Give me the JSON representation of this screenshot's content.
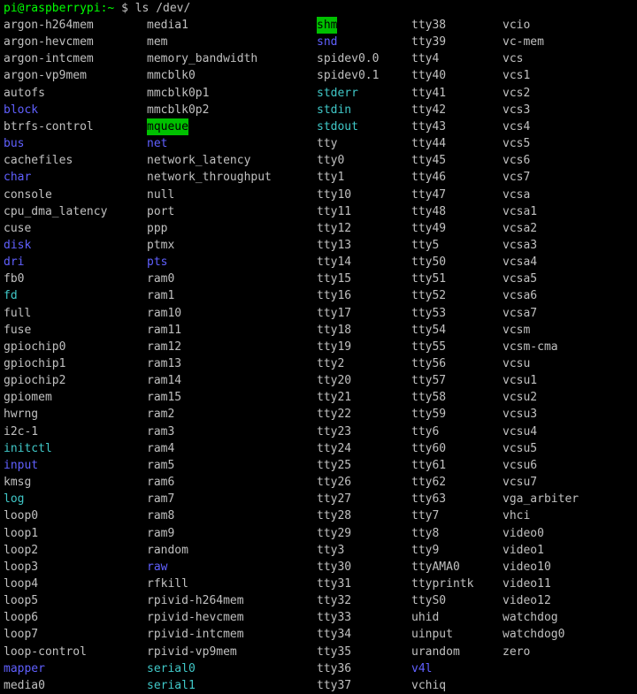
{
  "prompt": {
    "user_host": "pi@raspberrypi:",
    "cwd": "~",
    "symbol": "$",
    "command": "ls /dev/"
  },
  "colors": {
    "background": "#000000",
    "prompt": "#00ff00",
    "file": "#c0c0c0",
    "directory": "#6060ff",
    "symlink": "#40c8c8",
    "sticky_dir_bg": "#00c000"
  },
  "columns": [
    [
      {
        "n": "argon-h264mem",
        "t": "f"
      },
      {
        "n": "argon-hevcmem",
        "t": "f"
      },
      {
        "n": "argon-intcmem",
        "t": "f"
      },
      {
        "n": "argon-vp9mem",
        "t": "f"
      },
      {
        "n": "autofs",
        "t": "f"
      },
      {
        "n": "block",
        "t": "d"
      },
      {
        "n": "btrfs-control",
        "t": "f"
      },
      {
        "n": "bus",
        "t": "d"
      },
      {
        "n": "cachefiles",
        "t": "f"
      },
      {
        "n": "char",
        "t": "d"
      },
      {
        "n": "console",
        "t": "f"
      },
      {
        "n": "cpu_dma_latency",
        "t": "f"
      },
      {
        "n": "cuse",
        "t": "f"
      },
      {
        "n": "disk",
        "t": "d"
      },
      {
        "n": "dri",
        "t": "d"
      },
      {
        "n": "fb0",
        "t": "f"
      },
      {
        "n": "fd",
        "t": "l"
      },
      {
        "n": "full",
        "t": "f"
      },
      {
        "n": "fuse",
        "t": "f"
      },
      {
        "n": "gpiochip0",
        "t": "f"
      },
      {
        "n": "gpiochip1",
        "t": "f"
      },
      {
        "n": "gpiochip2",
        "t": "f"
      },
      {
        "n": "gpiomem",
        "t": "f"
      },
      {
        "n": "hwrng",
        "t": "f"
      },
      {
        "n": "i2c-1",
        "t": "f"
      },
      {
        "n": "initctl",
        "t": "l"
      },
      {
        "n": "input",
        "t": "d"
      },
      {
        "n": "kmsg",
        "t": "f"
      },
      {
        "n": "log",
        "t": "l"
      },
      {
        "n": "loop0",
        "t": "f"
      },
      {
        "n": "loop1",
        "t": "f"
      },
      {
        "n": "loop2",
        "t": "f"
      },
      {
        "n": "loop3",
        "t": "f"
      },
      {
        "n": "loop4",
        "t": "f"
      },
      {
        "n": "loop5",
        "t": "f"
      },
      {
        "n": "loop6",
        "t": "f"
      },
      {
        "n": "loop7",
        "t": "f"
      },
      {
        "n": "loop-control",
        "t": "f"
      },
      {
        "n": "mapper",
        "t": "d"
      },
      {
        "n": "media0",
        "t": "f"
      }
    ],
    [
      {
        "n": "media1",
        "t": "f"
      },
      {
        "n": "mem",
        "t": "f"
      },
      {
        "n": "memory_bandwidth",
        "t": "f"
      },
      {
        "n": "mmcblk0",
        "t": "f"
      },
      {
        "n": "mmcblk0p1",
        "t": "f"
      },
      {
        "n": "mmcblk0p2",
        "t": "f"
      },
      {
        "n": "mqueue",
        "t": "s"
      },
      {
        "n": "net",
        "t": "d"
      },
      {
        "n": "network_latency",
        "t": "f"
      },
      {
        "n": "network_throughput",
        "t": "f"
      },
      {
        "n": "null",
        "t": "f"
      },
      {
        "n": "port",
        "t": "f"
      },
      {
        "n": "ppp",
        "t": "f"
      },
      {
        "n": "ptmx",
        "t": "f"
      },
      {
        "n": "pts",
        "t": "d"
      },
      {
        "n": "ram0",
        "t": "f"
      },
      {
        "n": "ram1",
        "t": "f"
      },
      {
        "n": "ram10",
        "t": "f"
      },
      {
        "n": "ram11",
        "t": "f"
      },
      {
        "n": "ram12",
        "t": "f"
      },
      {
        "n": "ram13",
        "t": "f"
      },
      {
        "n": "ram14",
        "t": "f"
      },
      {
        "n": "ram15",
        "t": "f"
      },
      {
        "n": "ram2",
        "t": "f"
      },
      {
        "n": "ram3",
        "t": "f"
      },
      {
        "n": "ram4",
        "t": "f"
      },
      {
        "n": "ram5",
        "t": "f"
      },
      {
        "n": "ram6",
        "t": "f"
      },
      {
        "n": "ram7",
        "t": "f"
      },
      {
        "n": "ram8",
        "t": "f"
      },
      {
        "n": "ram9",
        "t": "f"
      },
      {
        "n": "random",
        "t": "f"
      },
      {
        "n": "raw",
        "t": "d"
      },
      {
        "n": "rfkill",
        "t": "f"
      },
      {
        "n": "rpivid-h264mem",
        "t": "f"
      },
      {
        "n": "rpivid-hevcmem",
        "t": "f"
      },
      {
        "n": "rpivid-intcmem",
        "t": "f"
      },
      {
        "n": "rpivid-vp9mem",
        "t": "f"
      },
      {
        "n": "serial0",
        "t": "l"
      },
      {
        "n": "serial1",
        "t": "l"
      }
    ],
    [
      {
        "n": "shm",
        "t": "s"
      },
      {
        "n": "snd",
        "t": "d"
      },
      {
        "n": "spidev0.0",
        "t": "f"
      },
      {
        "n": "spidev0.1",
        "t": "f"
      },
      {
        "n": "stderr",
        "t": "l"
      },
      {
        "n": "stdin",
        "t": "l"
      },
      {
        "n": "stdout",
        "t": "l"
      },
      {
        "n": "tty",
        "t": "f"
      },
      {
        "n": "tty0",
        "t": "f"
      },
      {
        "n": "tty1",
        "t": "f"
      },
      {
        "n": "tty10",
        "t": "f"
      },
      {
        "n": "tty11",
        "t": "f"
      },
      {
        "n": "tty12",
        "t": "f"
      },
      {
        "n": "tty13",
        "t": "f"
      },
      {
        "n": "tty14",
        "t": "f"
      },
      {
        "n": "tty15",
        "t": "f"
      },
      {
        "n": "tty16",
        "t": "f"
      },
      {
        "n": "tty17",
        "t": "f"
      },
      {
        "n": "tty18",
        "t": "f"
      },
      {
        "n": "tty19",
        "t": "f"
      },
      {
        "n": "tty2",
        "t": "f"
      },
      {
        "n": "tty20",
        "t": "f"
      },
      {
        "n": "tty21",
        "t": "f"
      },
      {
        "n": "tty22",
        "t": "f"
      },
      {
        "n": "tty23",
        "t": "f"
      },
      {
        "n": "tty24",
        "t": "f"
      },
      {
        "n": "tty25",
        "t": "f"
      },
      {
        "n": "tty26",
        "t": "f"
      },
      {
        "n": "tty27",
        "t": "f"
      },
      {
        "n": "tty28",
        "t": "f"
      },
      {
        "n": "tty29",
        "t": "f"
      },
      {
        "n": "tty3",
        "t": "f"
      },
      {
        "n": "tty30",
        "t": "f"
      },
      {
        "n": "tty31",
        "t": "f"
      },
      {
        "n": "tty32",
        "t": "f"
      },
      {
        "n": "tty33",
        "t": "f"
      },
      {
        "n": "tty34",
        "t": "f"
      },
      {
        "n": "tty35",
        "t": "f"
      },
      {
        "n": "tty36",
        "t": "f"
      },
      {
        "n": "tty37",
        "t": "f"
      }
    ],
    [
      {
        "n": "tty38",
        "t": "f"
      },
      {
        "n": "tty39",
        "t": "f"
      },
      {
        "n": "tty4",
        "t": "f"
      },
      {
        "n": "tty40",
        "t": "f"
      },
      {
        "n": "tty41",
        "t": "f"
      },
      {
        "n": "tty42",
        "t": "f"
      },
      {
        "n": "tty43",
        "t": "f"
      },
      {
        "n": "tty44",
        "t": "f"
      },
      {
        "n": "tty45",
        "t": "f"
      },
      {
        "n": "tty46",
        "t": "f"
      },
      {
        "n": "tty47",
        "t": "f"
      },
      {
        "n": "tty48",
        "t": "f"
      },
      {
        "n": "tty49",
        "t": "f"
      },
      {
        "n": "tty5",
        "t": "f"
      },
      {
        "n": "tty50",
        "t": "f"
      },
      {
        "n": "tty51",
        "t": "f"
      },
      {
        "n": "tty52",
        "t": "f"
      },
      {
        "n": "tty53",
        "t": "f"
      },
      {
        "n": "tty54",
        "t": "f"
      },
      {
        "n": "tty55",
        "t": "f"
      },
      {
        "n": "tty56",
        "t": "f"
      },
      {
        "n": "tty57",
        "t": "f"
      },
      {
        "n": "tty58",
        "t": "f"
      },
      {
        "n": "tty59",
        "t": "f"
      },
      {
        "n": "tty6",
        "t": "f"
      },
      {
        "n": "tty60",
        "t": "f"
      },
      {
        "n": "tty61",
        "t": "f"
      },
      {
        "n": "tty62",
        "t": "f"
      },
      {
        "n": "tty63",
        "t": "f"
      },
      {
        "n": "tty7",
        "t": "f"
      },
      {
        "n": "tty8",
        "t": "f"
      },
      {
        "n": "tty9",
        "t": "f"
      },
      {
        "n": "ttyAMA0",
        "t": "f"
      },
      {
        "n": "ttyprintk",
        "t": "f"
      },
      {
        "n": "ttyS0",
        "t": "f"
      },
      {
        "n": "uhid",
        "t": "f"
      },
      {
        "n": "uinput",
        "t": "f"
      },
      {
        "n": "urandom",
        "t": "f"
      },
      {
        "n": "v4l",
        "t": "d"
      },
      {
        "n": "vchiq",
        "t": "f"
      }
    ],
    [
      {
        "n": "vcio",
        "t": "f"
      },
      {
        "n": "vc-mem",
        "t": "f"
      },
      {
        "n": "vcs",
        "t": "f"
      },
      {
        "n": "vcs1",
        "t": "f"
      },
      {
        "n": "vcs2",
        "t": "f"
      },
      {
        "n": "vcs3",
        "t": "f"
      },
      {
        "n": "vcs4",
        "t": "f"
      },
      {
        "n": "vcs5",
        "t": "f"
      },
      {
        "n": "vcs6",
        "t": "f"
      },
      {
        "n": "vcs7",
        "t": "f"
      },
      {
        "n": "vcsa",
        "t": "f"
      },
      {
        "n": "vcsa1",
        "t": "f"
      },
      {
        "n": "vcsa2",
        "t": "f"
      },
      {
        "n": "vcsa3",
        "t": "f"
      },
      {
        "n": "vcsa4",
        "t": "f"
      },
      {
        "n": "vcsa5",
        "t": "f"
      },
      {
        "n": "vcsa6",
        "t": "f"
      },
      {
        "n": "vcsa7",
        "t": "f"
      },
      {
        "n": "vcsm",
        "t": "f"
      },
      {
        "n": "vcsm-cma",
        "t": "f"
      },
      {
        "n": "vcsu",
        "t": "f"
      },
      {
        "n": "vcsu1",
        "t": "f"
      },
      {
        "n": "vcsu2",
        "t": "f"
      },
      {
        "n": "vcsu3",
        "t": "f"
      },
      {
        "n": "vcsu4",
        "t": "f"
      },
      {
        "n": "vcsu5",
        "t": "f"
      },
      {
        "n": "vcsu6",
        "t": "f"
      },
      {
        "n": "vcsu7",
        "t": "f"
      },
      {
        "n": "vga_arbiter",
        "t": "f"
      },
      {
        "n": "vhci",
        "t": "f"
      },
      {
        "n": "video0",
        "t": "f"
      },
      {
        "n": "video1",
        "t": "f"
      },
      {
        "n": "video10",
        "t": "f"
      },
      {
        "n": "video11",
        "t": "f"
      },
      {
        "n": "video12",
        "t": "f"
      },
      {
        "n": "watchdog",
        "t": "f"
      },
      {
        "n": "watchdog0",
        "t": "f"
      },
      {
        "n": "zero",
        "t": "f"
      }
    ]
  ]
}
